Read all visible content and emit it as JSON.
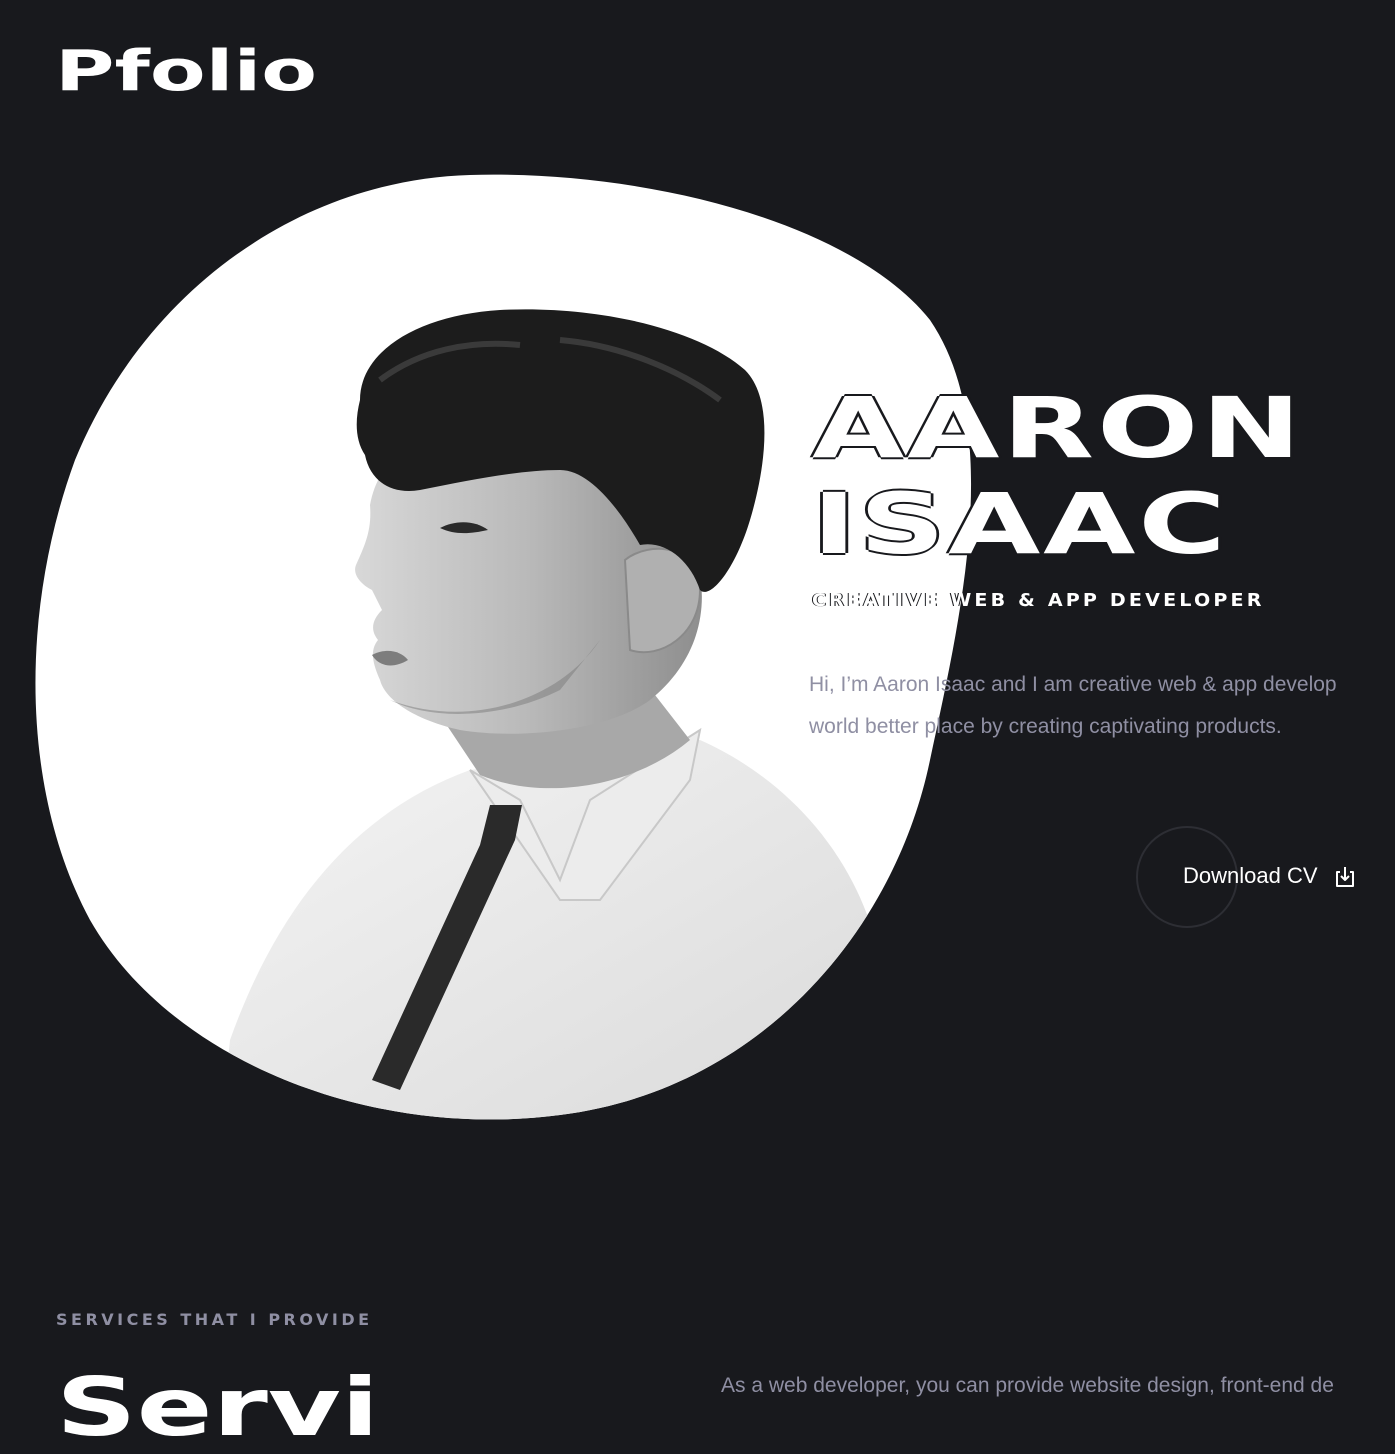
{
  "brand": {
    "logo_text": "Pfolio"
  },
  "hero": {
    "first_name": "AARON",
    "last_name": "ISAAC",
    "role": "CREATIVE WEB & APP DEVELOPER",
    "intro_line1": "Hi, I’m Aaron Isaac and I am creative web & app develop",
    "intro_line2": "world better place by creating captivating products.",
    "cta_label": "Download CV",
    "cta_icon": "download-icon",
    "portrait_alt": "Black and white profile portrait"
  },
  "services": {
    "kicker": "SERVICES THAT I PROVIDE",
    "title": "Servi",
    "description": "As a web developer, you can provide website design, front-end de"
  },
  "colors": {
    "background": "#18191d",
    "text_primary": "#ffffff",
    "text_muted": "#8f8fa3",
    "ring": "#2d2e34"
  }
}
